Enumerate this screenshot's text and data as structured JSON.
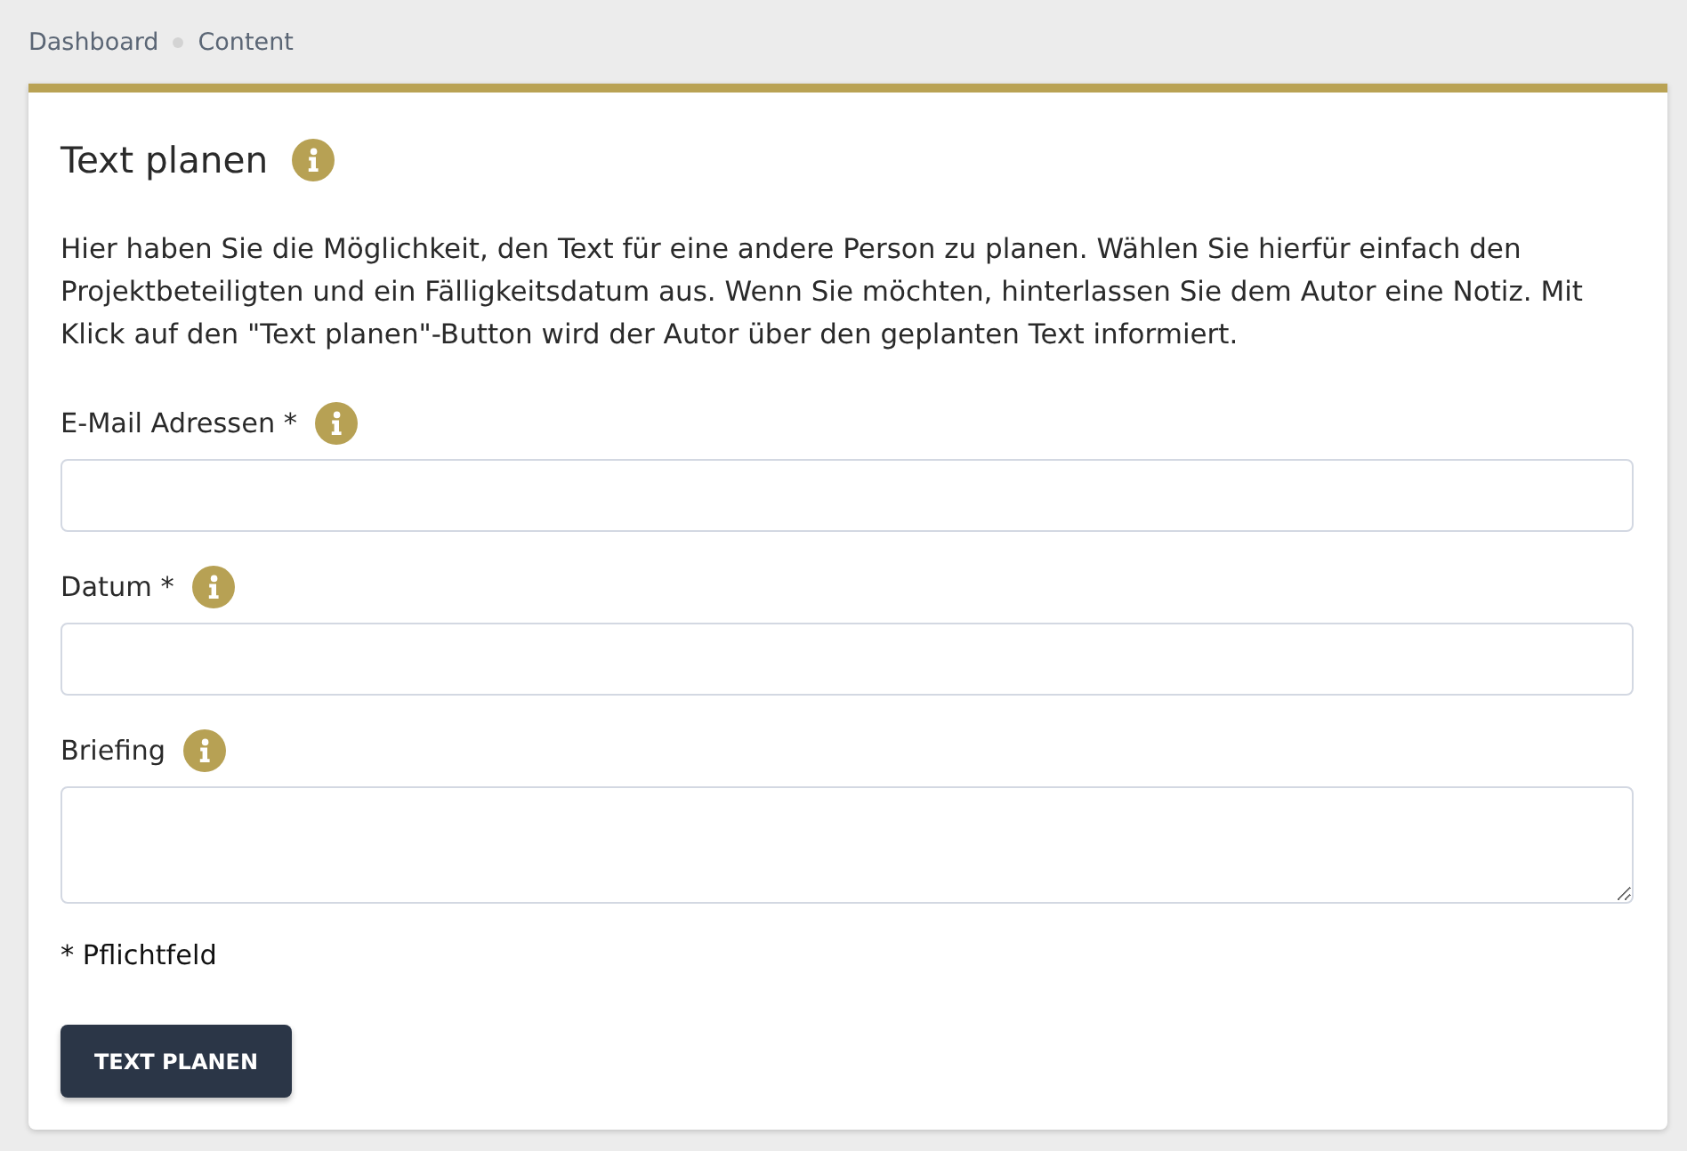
{
  "breadcrumb": [
    {
      "label": "Dashboard"
    },
    {
      "label": "Content"
    }
  ],
  "card": {
    "title": "Text planen",
    "description": "Hier haben Sie die Möglichkeit, den Text für eine andere Person zu planen. Wählen Sie hierfür einfach den Projektbeteiligten und ein Fälligkeitsdatum aus. Wenn Sie möchten, hinterlassen Sie dem Autor eine Notiz. Mit Klick auf den \"Text planen\"-Button wird der Autor über den geplanten Text informiert.",
    "fields": [
      {
        "label": "E-Mail Adressen *",
        "kind": "input"
      },
      {
        "label": "Datum *",
        "kind": "input"
      },
      {
        "label": "Briefing",
        "kind": "textarea"
      }
    ],
    "note": "* Pflichtfeld",
    "button": "TEXT PLANEN"
  }
}
